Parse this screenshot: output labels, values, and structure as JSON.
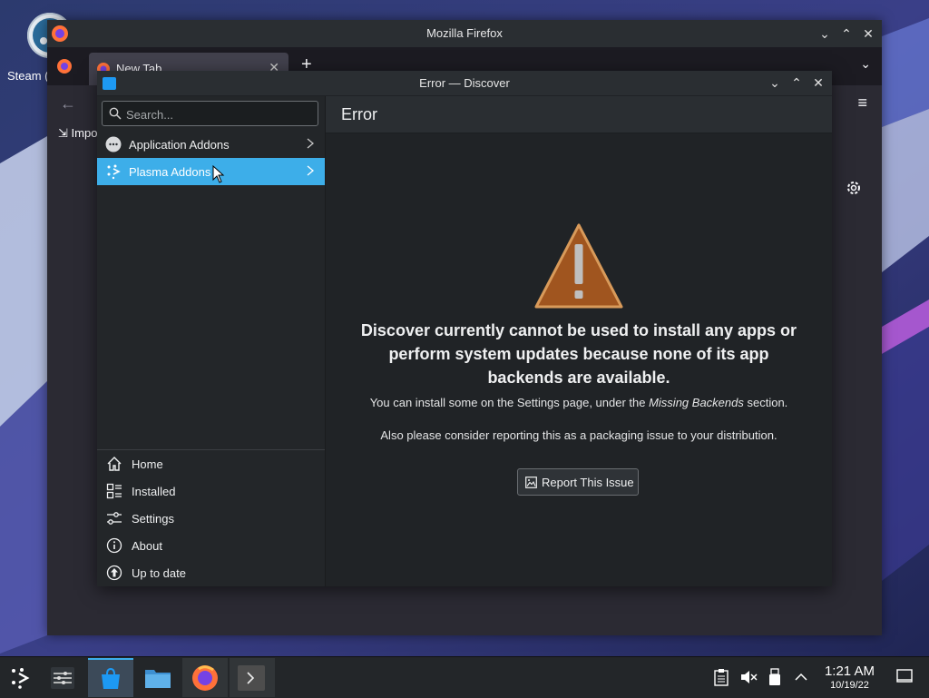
{
  "desktop": {
    "steam_icon_label": "Steam (Installer)"
  },
  "firefox": {
    "title": "Mozilla Firefox",
    "tab_title": "New Tab",
    "bookmark_label": "Import bookmarks..."
  },
  "discover": {
    "title": "Error — Discover",
    "search_placeholder": "Search...",
    "categories": [
      {
        "label": "Application Addons",
        "icon": "addons-icon",
        "active": false
      },
      {
        "label": "Plasma Addons",
        "icon": "plasma-icon",
        "active": true
      }
    ],
    "nav": [
      {
        "label": "Home",
        "icon": "home-icon"
      },
      {
        "label": "Installed",
        "icon": "installed-icon"
      },
      {
        "label": "Settings",
        "icon": "settings-sliders-icon"
      },
      {
        "label": "About",
        "icon": "info-icon"
      },
      {
        "label": "Up to date",
        "icon": "update-icon"
      }
    ],
    "page_title": "Error",
    "error_heading": "Discover currently cannot be used to install any apps or perform system updates because none of its app backends are available.",
    "hint_prefix": "You can install some on the Settings page, under the ",
    "hint_em": "Missing Backends",
    "hint_suffix": " section.",
    "packaging_note": "Also please consider reporting this as a packaging issue to your distribution.",
    "report_button": "Report This Issue"
  },
  "taskbar": {
    "time": "1:21 AM",
    "date": "10/19/22"
  },
  "colors": {
    "accent": "#3daee9",
    "warning": "#b36b2e"
  }
}
